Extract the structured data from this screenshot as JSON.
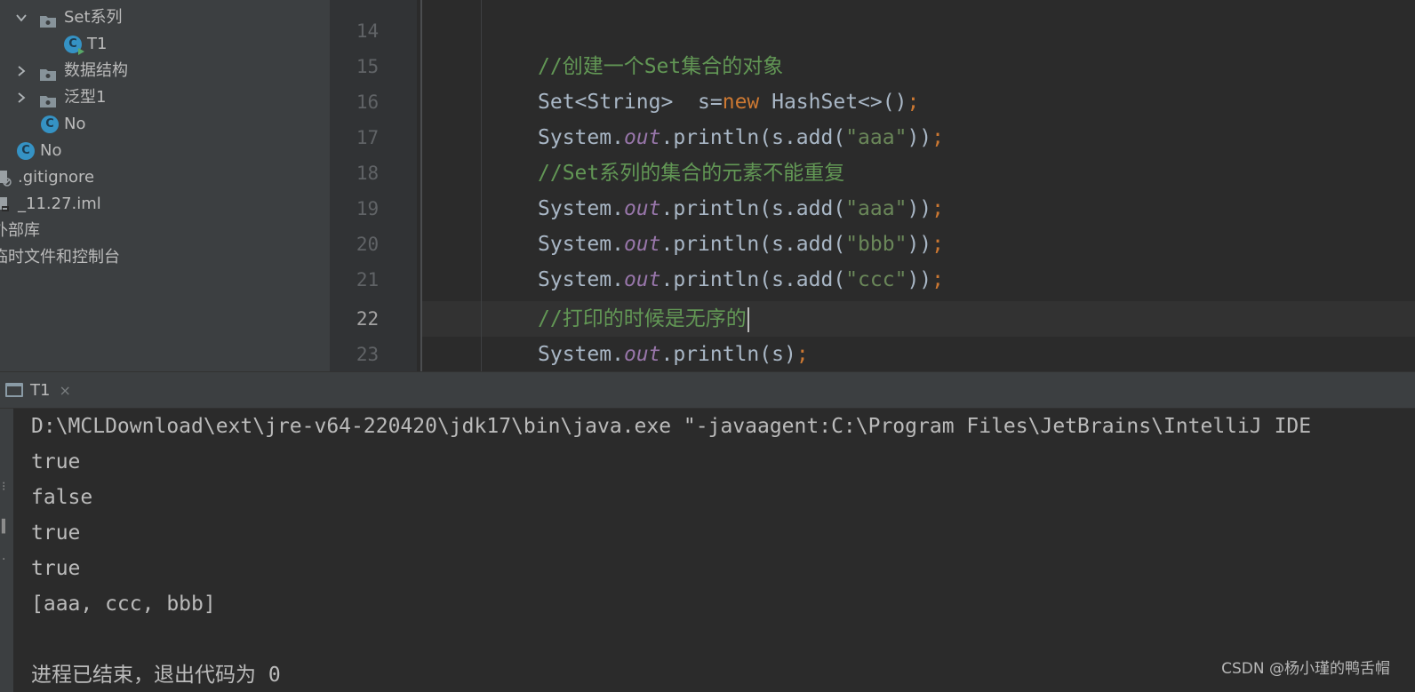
{
  "project_tree": {
    "items": [
      {
        "label": "Set系列",
        "type": "folder",
        "expanded": true
      },
      {
        "label": "T1",
        "type": "class-runnable"
      },
      {
        "label": "数据结构",
        "type": "folder",
        "expanded": false
      },
      {
        "label": "泛型1",
        "type": "folder",
        "expanded": false
      },
      {
        "label": "No",
        "type": "class"
      },
      {
        "label": "No",
        "type": "class"
      },
      {
        "label": ".gitignore",
        "type": "file"
      },
      {
        "label": "_11.27.iml",
        "type": "file"
      },
      {
        "label": "外部库",
        "type": "library"
      },
      {
        "label": "临时文件和控制台",
        "type": "scratches"
      }
    ]
  },
  "editor": {
    "line_numbers": [
      "14",
      "15",
      "16",
      "17",
      "18",
      "19",
      "20",
      "21",
      "22",
      "23"
    ],
    "current_line": "22",
    "lines": [
      {
        "parts": []
      },
      {
        "parts": [
          {
            "t": "//创建一个Set集合的对象",
            "k": "comment"
          }
        ]
      },
      {
        "parts": [
          {
            "t": "Set<String>  s=",
            "k": "plain"
          },
          {
            "t": "new",
            "k": "keyword"
          },
          {
            "t": " HashSet<>()",
            "k": "plain"
          },
          {
            "t": ";",
            "k": "punct"
          }
        ]
      },
      {
        "parts": [
          {
            "t": "System.",
            "k": "plain"
          },
          {
            "t": "out",
            "k": "static"
          },
          {
            "t": ".println(s.add(",
            "k": "plain"
          },
          {
            "t": "\"aaa\"",
            "k": "string"
          },
          {
            "t": "))",
            "k": "plain"
          },
          {
            "t": ";",
            "k": "punct"
          }
        ]
      },
      {
        "parts": [
          {
            "t": "//Set系列的集合的元素不能重复",
            "k": "comment"
          }
        ]
      },
      {
        "parts": [
          {
            "t": "System.",
            "k": "plain"
          },
          {
            "t": "out",
            "k": "static"
          },
          {
            "t": ".println(s.add(",
            "k": "plain"
          },
          {
            "t": "\"aaa\"",
            "k": "string"
          },
          {
            "t": "))",
            "k": "plain"
          },
          {
            "t": ";",
            "k": "punct"
          }
        ]
      },
      {
        "parts": [
          {
            "t": "System.",
            "k": "plain"
          },
          {
            "t": "out",
            "k": "static"
          },
          {
            "t": ".println(s.add(",
            "k": "plain"
          },
          {
            "t": "\"bbb\"",
            "k": "string"
          },
          {
            "t": "))",
            "k": "plain"
          },
          {
            "t": ";",
            "k": "punct"
          }
        ]
      },
      {
        "parts": [
          {
            "t": "System.",
            "k": "plain"
          },
          {
            "t": "out",
            "k": "static"
          },
          {
            "t": ".println(s.add(",
            "k": "plain"
          },
          {
            "t": "\"ccc\"",
            "k": "string"
          },
          {
            "t": "))",
            "k": "plain"
          },
          {
            "t": ";",
            "k": "punct"
          }
        ]
      },
      {
        "parts": [
          {
            "t": "//打印的时候是无序的",
            "k": "comment"
          }
        ],
        "caret": true
      },
      {
        "parts": [
          {
            "t": "System.",
            "k": "plain"
          },
          {
            "t": "out",
            "k": "static"
          },
          {
            "t": ".println(s)",
            "k": "plain"
          },
          {
            "t": ";",
            "k": "punct"
          }
        ]
      }
    ]
  },
  "run_panel": {
    "tab_label": "T1",
    "close_glyph": "×",
    "console_lines": [
      "D:\\MCLDownload\\ext\\jre-v64-220420\\jdk17\\bin\\java.exe \"-javaagent:C:\\Program Files\\JetBrains\\IntelliJ IDE",
      "true",
      "false",
      "true",
      "true",
      "[aaa, ccc, bbb]",
      "",
      "进程已结束，退出代码为 0"
    ]
  },
  "watermark": "CSDN @杨小瑾的鸭舌帽",
  "colors": {
    "comment": "#629755",
    "keyword": "#cc7832",
    "static_field": "#9876aa",
    "string": "#6a8759",
    "default_text": "#a9b7c6"
  }
}
